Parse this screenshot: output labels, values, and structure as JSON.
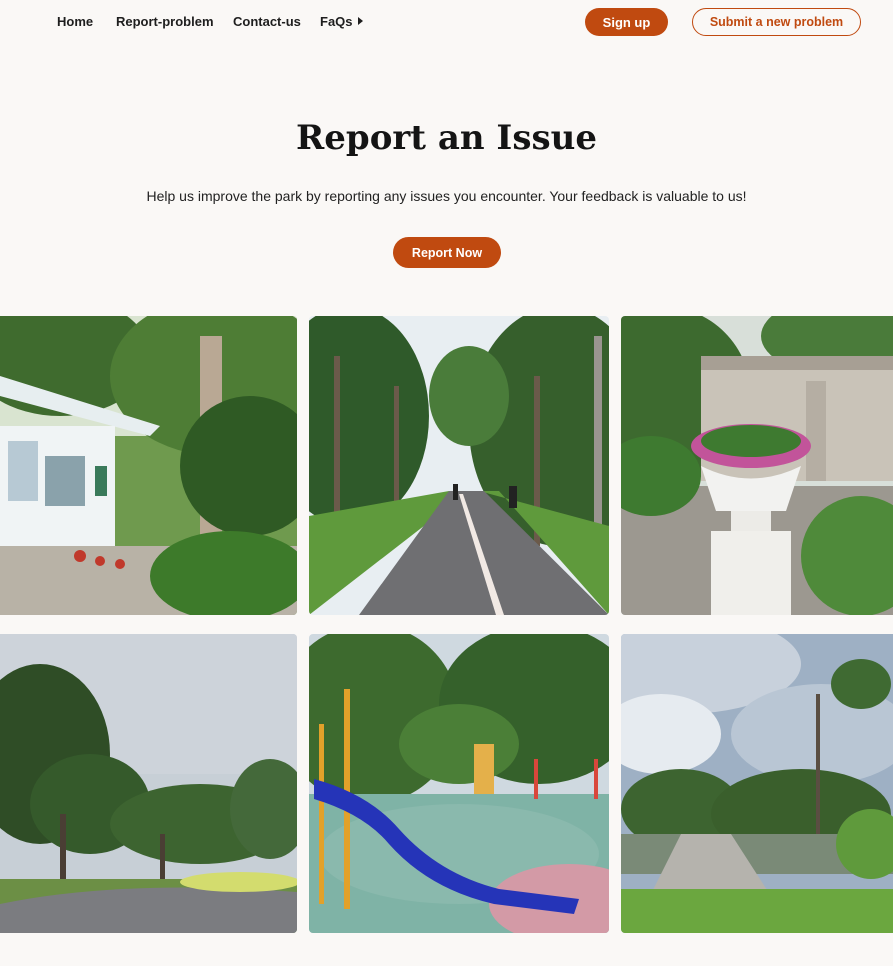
{
  "nav": {
    "home": "Home",
    "report_problem": "Report-problem",
    "contact_us": "Contact-us",
    "faqs": "FaQs",
    "sign_up": "Sign up",
    "submit_problem": "Submit a new problem"
  },
  "hero": {
    "title": "Report an Issue",
    "subtitle": "Help us improve the park by reporting any issues you encounter. Your feedback is valuable to us!",
    "cta": "Report Now"
  },
  "colors": {
    "accent": "#c04a10",
    "background": "#faf8f6"
  },
  "gallery": [
    {
      "alt": "Park office building among palm trees"
    },
    {
      "alt": "Palm-lined jogging path"
    },
    {
      "alt": "White flower planter at park entrance"
    },
    {
      "alt": "Tree-lined park road"
    },
    {
      "alt": "Children's playground with blue slide"
    },
    {
      "alt": "Wooden pier at park lake"
    }
  ]
}
